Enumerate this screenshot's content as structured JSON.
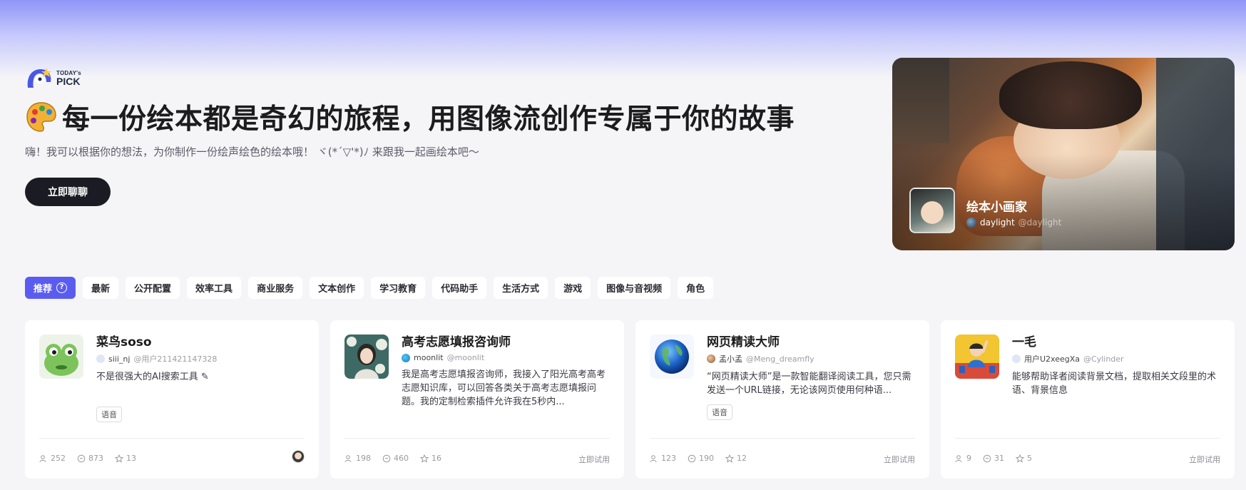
{
  "brand": {
    "logo_small": "TODAY's",
    "logo_big": "PICK"
  },
  "hero": {
    "title": "每一份绘本都是奇幻的旅程，用图像流创作专属于你的故事",
    "subtitle": "嗨！我可以根据你的想法，为你制作一份绘声绘色的绘本哦！ ヾ(*´▽'*)ﾉ 来跟我一起画绘本吧～",
    "cta_label": "立即聊聊",
    "icon": "palette-icon"
  },
  "featured": {
    "title": "绘本小画家",
    "author": "daylight",
    "handle": "@daylight"
  },
  "tabs": [
    {
      "label": "推荐",
      "active": true
    },
    {
      "label": "最新"
    },
    {
      "label": "公开配置"
    },
    {
      "label": "效率工具"
    },
    {
      "label": "商业服务"
    },
    {
      "label": "文本创作"
    },
    {
      "label": "学习教育"
    },
    {
      "label": "代码助手"
    },
    {
      "label": "生活方式"
    },
    {
      "label": "游戏"
    },
    {
      "label": "图像与音视频"
    },
    {
      "label": "角色"
    }
  ],
  "cards": [
    {
      "name": "菜鸟soso",
      "author": "siii_nj",
      "handle": "@用户211421147328",
      "desc": "不是很强大的AI搜索工具",
      "tag": "语音",
      "users": "252",
      "chats": "873",
      "stars": "13"
    },
    {
      "name": "高考志愿填报咨询师",
      "author": "moonlit",
      "handle": "@moonlit",
      "desc": "我是高考志愿填报咨询师，我接入了阳光高考高考志愿知识库，可以回答各类关于高考志愿填报问题。我的定制检索插件允许我在5秒内...",
      "users": "198",
      "chats": "460",
      "stars": "16",
      "try_label": "立即试用"
    },
    {
      "name": "网页精读大师",
      "author": "孟小孟",
      "handle": "@Meng_dreamfly",
      "desc": "“网页精读大师”是一款智能翻译阅读工具，您只需发送一个URL链接，无论该网页使用何种语...",
      "tag": "语音",
      "users": "123",
      "chats": "190",
      "stars": "12",
      "try_label": "立即试用"
    },
    {
      "name": "一毛",
      "author": "用户U2xeegXa",
      "handle": "@Cylinder",
      "desc": "能够帮助译者阅读背景文档，提取相关文段里的术语、背景信息",
      "users": "9",
      "chats": "31",
      "stars": "5",
      "try_label": "立即试用"
    }
  ]
}
